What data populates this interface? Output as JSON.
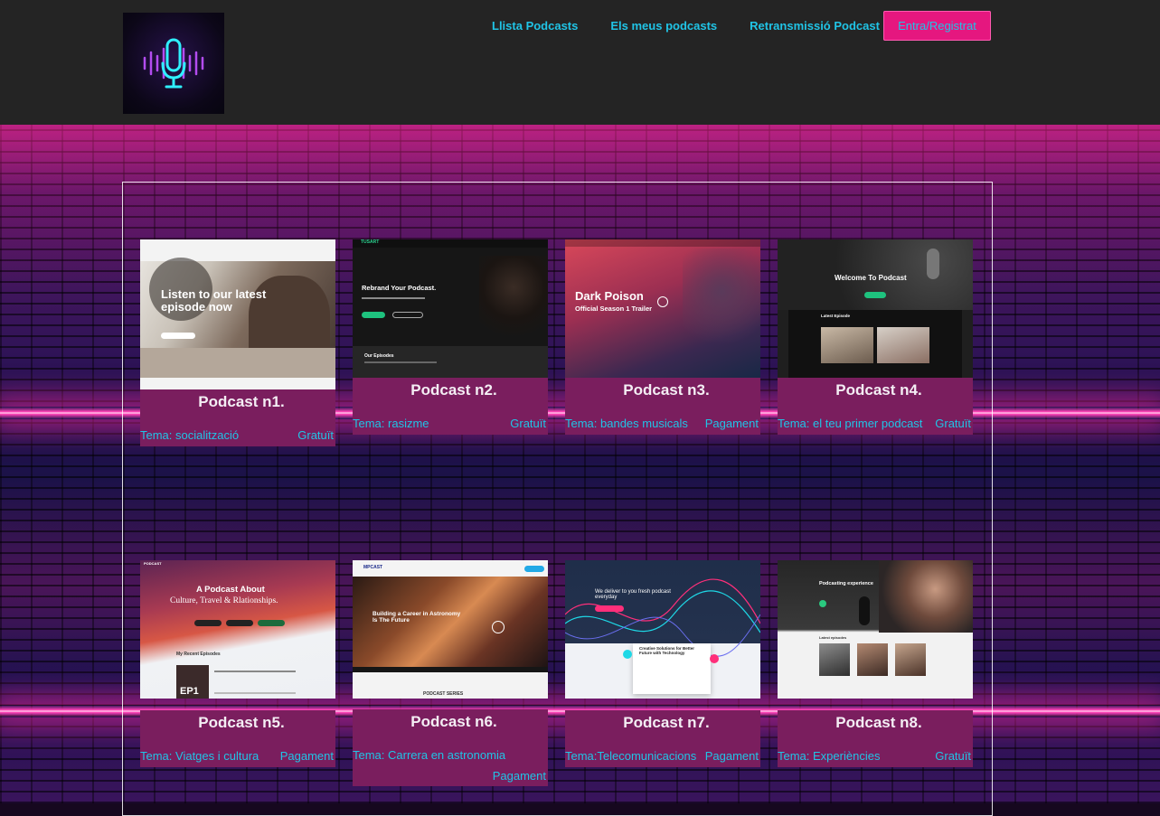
{
  "nav": {
    "items": [
      "Llista Podcasts",
      "Els meus podcasts",
      "Retransmissió Podcast"
    ],
    "login": "Entra/Registrat"
  },
  "colors": {
    "accent": "#20c4e6",
    "button": "#e5177f",
    "card": "#7a1e5e",
    "header": "#242424"
  },
  "podcasts": [
    {
      "title": "Podcast n1.",
      "tema": "Tema: socialització",
      "price": "Gratuït",
      "thumb": {
        "headline": "Listen to our latest episode now"
      }
    },
    {
      "title": "Podcast n2.",
      "tema": "Tema: rasizme",
      "price": "Gratuït",
      "thumb": {
        "headline": "Rebrand Your Podcast.",
        "section": "Our Episodes",
        "brand": "TUSART"
      }
    },
    {
      "title": "Podcast n3.",
      "tema": "Tema: bandes musicals",
      "price": "Pagament",
      "thumb": {
        "headline": "Dark Poison",
        "sub": "Official Season 1 Trailer"
      }
    },
    {
      "title": "Podcast n4.",
      "tema": "Tema: el teu primer podcast",
      "price": "Gratuït",
      "thumb": {
        "headline": "Welcome To Podcast",
        "section": "Latest Episode"
      }
    },
    {
      "title": "Podcast n5.",
      "tema": "Tema: Viatges i cultura",
      "price": "Pagament",
      "thumb": {
        "headline": "A Podcast About",
        "sub": "Culture, Travel & Rlationships.",
        "section": "My Recent Episodes",
        "tag": "EP1",
        "brand": "PODCAST"
      }
    },
    {
      "title": "Podcast n6.",
      "tema": "Tema: Carrera en astronomia",
      "price": "Pagament",
      "thumb": {
        "headline": "Building a Career in Astronomy Is The Future",
        "section": "PODCAST SERIES",
        "brand": "MPCAST"
      }
    },
    {
      "title": "Podcast n7.",
      "tema": "Tema:Telecomunicacions",
      "price": "Pagament",
      "thumb": {
        "headline": "We deliver to you fresh podcast everyday",
        "sub": "Creative Solutions for Better Future with Technology"
      }
    },
    {
      "title": "Podcast n8.",
      "tema": "Tema: Experiències",
      "price": "Gratuït",
      "thumb": {
        "headline": "Podcasting experience",
        "section": "Latest episodes"
      }
    }
  ]
}
